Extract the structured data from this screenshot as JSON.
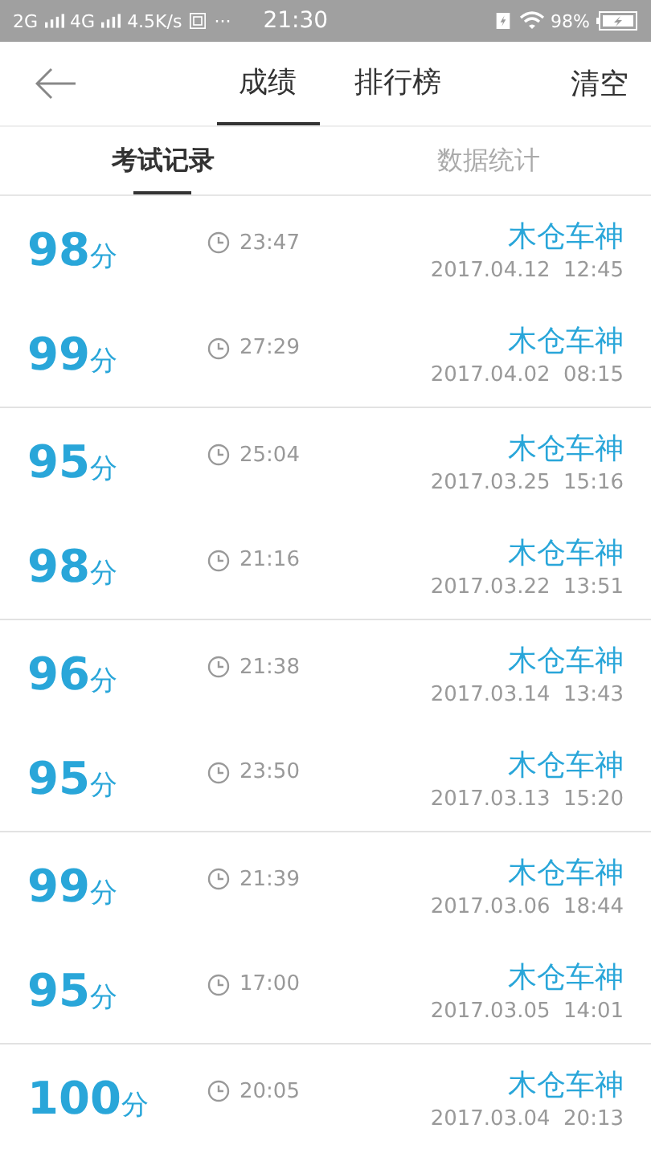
{
  "status_bar": {
    "network_1": "2G",
    "network_2": "4G",
    "speed": "4.5K/s",
    "dots": "···",
    "time": "21:30",
    "battery": "98%"
  },
  "header": {
    "tabs": [
      {
        "label": "成绩",
        "selected": true
      },
      {
        "label": "排行榜",
        "selected": false
      }
    ],
    "action": "清空"
  },
  "sub_tabs": [
    {
      "label": "考试记录",
      "selected": true
    },
    {
      "label": "数据统计",
      "selected": false
    }
  ],
  "records": [
    {
      "score": "98",
      "unit": "分",
      "duration": "23:47",
      "name": "木仓车神",
      "date": "2017.04.12  12:45"
    },
    {
      "score": "99",
      "unit": "分",
      "duration": "27:29",
      "name": "木仓车神",
      "date": "2017.04.02  08:15"
    },
    {
      "score": "95",
      "unit": "分",
      "duration": "25:04",
      "name": "木仓车神",
      "date": "2017.03.25  15:16"
    },
    {
      "score": "98",
      "unit": "分",
      "duration": "21:16",
      "name": "木仓车神",
      "date": "2017.03.22  13:51"
    },
    {
      "score": "96",
      "unit": "分",
      "duration": "21:38",
      "name": "木仓车神",
      "date": "2017.03.14  13:43"
    },
    {
      "score": "95",
      "unit": "分",
      "duration": "23:50",
      "name": "木仓车神",
      "date": "2017.03.13  15:20"
    },
    {
      "score": "99",
      "unit": "分",
      "duration": "21:39",
      "name": "木仓车神",
      "date": "2017.03.06  18:44"
    },
    {
      "score": "95",
      "unit": "分",
      "duration": "17:00",
      "name": "木仓车神",
      "date": "2017.03.05  14:01"
    },
    {
      "score": "100",
      "unit": "分",
      "duration": "20:05",
      "name": "木仓车神",
      "date": "2017.03.04  20:13"
    }
  ]
}
